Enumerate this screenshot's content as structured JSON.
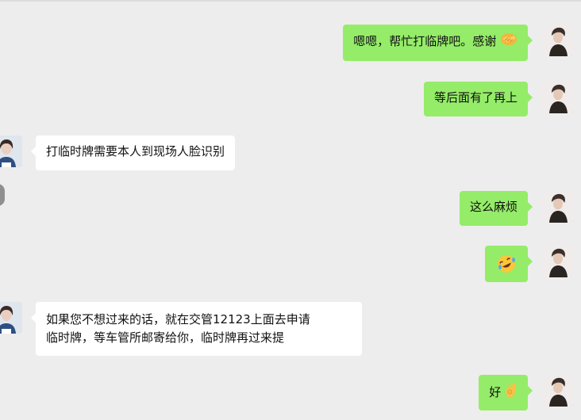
{
  "messages": [
    {
      "id": "m1",
      "side": "self",
      "text": "嗯嗯，帮忙打临牌吧。感谢",
      "emoji": "handshake"
    },
    {
      "id": "m2",
      "side": "self",
      "text": "等后面有了再上"
    },
    {
      "id": "m3",
      "side": "other",
      "text": "打临时牌需要本人到现场人脸识别"
    },
    {
      "id": "m4",
      "side": "self",
      "text": "这么麻烦"
    },
    {
      "id": "m5",
      "side": "self",
      "text": "",
      "emoji": "rolling-on-floor-laughing"
    },
    {
      "id": "m6",
      "side": "other",
      "lines": [
        "如果您不想过来的话，就在交管12123上面去申请",
        "临时牌，等车管所邮寄给你，临时牌再过来提"
      ]
    },
    {
      "id": "m7",
      "side": "self",
      "text": "好",
      "emoji": "ok-hand"
    }
  ],
  "colors": {
    "background": "#ededed",
    "self_bubble": "#95ec69",
    "other_bubble": "#ffffff"
  }
}
